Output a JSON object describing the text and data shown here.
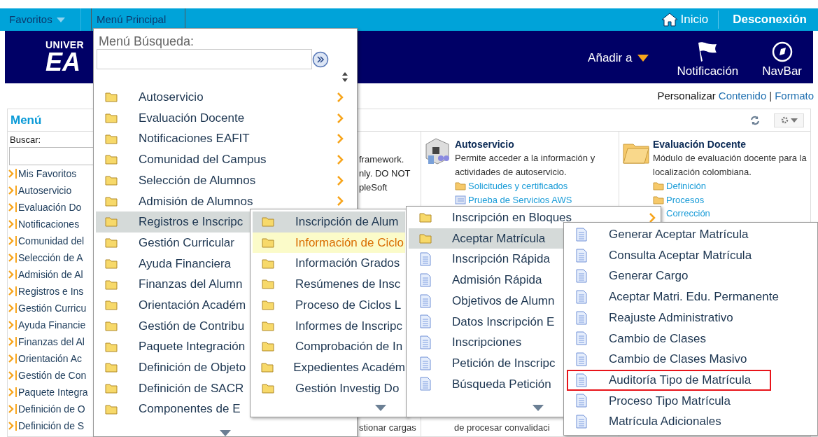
{
  "top_nav": {
    "favorites": "Favoritos",
    "main_menu": "Menú Principal",
    "home": "Inicio",
    "logout": "Desconexión"
  },
  "banner": {
    "logo_line_1": "UNIVER",
    "logo_line_2": "EA",
    "add_to": "Añadir a",
    "notification": "Notificación",
    "navbar": "NavBar"
  },
  "personalize": {
    "label": "Personalizar",
    "content_link": "Contenido",
    "separator": "|",
    "layout_link": "Formato"
  },
  "left_menu": {
    "title": "Menú",
    "search_label": "Buscar:",
    "items": [
      "Mis Favoritos",
      "Autoservicio",
      "Evaluación Do",
      "Notificaciones",
      "Comunidad del",
      "Selección de A",
      "Admisión de Al",
      "Registros e Ins",
      "Gestión Curricu",
      "Ayuda Financie",
      "Finanzas del Al",
      "Orientación Ac",
      "Gestión de Con",
      "Paquete Integra",
      "Definición de O",
      "Definición de S"
    ]
  },
  "pods": [
    {
      "kind": "partial",
      "lines": [
        "framework.",
        "nly. DO NOT",
        "pleSoft"
      ],
      "footer": "stionar cargas"
    },
    {
      "kind": "self_service",
      "title": "Autoservicio",
      "description": "Permite acceder a la información y actividades de autoservicio.",
      "links": [
        {
          "kind": "folder",
          "label": "Solicitudes y certificados"
        },
        {
          "kind": "page",
          "label": "Prueba de Servicios AWS"
        }
      ],
      "footer": "de procesar convalidaci"
    },
    {
      "kind": "folder",
      "title": "Evaluación Docente",
      "description": "Módulo de evaluación docente para la localización colombiana.",
      "links": [
        {
          "kind": "folder",
          "label": "Definición"
        },
        {
          "kind": "folder",
          "label": "Procesos"
        },
        {
          "kind": "none",
          "label": "Corrección"
        }
      ]
    }
  ],
  "menu_search": {
    "label": "Menú Búsqueda:"
  },
  "menus": [
    {
      "items": [
        {
          "label": "Autoservicio",
          "kind": "folder",
          "selected": false,
          "submenu": true
        },
        {
          "label": "Evaluación Docente",
          "kind": "folder",
          "selected": false,
          "submenu": true
        },
        {
          "label": "Notificaciones EAFIT",
          "kind": "folder",
          "selected": false,
          "submenu": true
        },
        {
          "label": "Comunidad del Campus",
          "kind": "folder",
          "selected": false,
          "submenu": true
        },
        {
          "label": "Selección de Alumnos",
          "kind": "folder",
          "selected": false,
          "submenu": true
        },
        {
          "label": "Admisión de Alumnos",
          "kind": "folder",
          "selected": false,
          "submenu": true
        },
        {
          "label": "Registros e Inscripc",
          "kind": "folder",
          "selected": true,
          "submenu": false
        },
        {
          "label": "Gestión Curricular",
          "kind": "folder",
          "selected": false,
          "submenu": false
        },
        {
          "label": "Ayuda Financiera",
          "kind": "folder",
          "selected": false,
          "submenu": false
        },
        {
          "label": "Finanzas del Alumn",
          "kind": "folder",
          "selected": false,
          "submenu": false
        },
        {
          "label": "Orientación Académ",
          "kind": "folder",
          "selected": false,
          "submenu": false
        },
        {
          "label": "Gestión de Contribu",
          "kind": "folder",
          "selected": false,
          "submenu": false
        },
        {
          "label": "Paquete Integración",
          "kind": "folder",
          "selected": false,
          "submenu": false
        },
        {
          "label": "Definición de Objeto",
          "kind": "folder",
          "selected": false,
          "submenu": false
        },
        {
          "label": "Definición de SACR",
          "kind": "folder",
          "selected": false,
          "submenu": false
        },
        {
          "label": "Componentes de E",
          "kind": "folder",
          "selected": false,
          "submenu": false
        }
      ]
    },
    {
      "items": [
        {
          "label": "Inscripción de Alum",
          "kind": "folder",
          "selected": true,
          "hovered": false
        },
        {
          "label": "Información de Ciclo",
          "kind": "folder",
          "selected": false,
          "hovered": true
        },
        {
          "label": "Información Grados",
          "kind": "folder",
          "selected": false,
          "hovered": false
        },
        {
          "label": "Resúmenes de Insc",
          "kind": "folder",
          "selected": false,
          "hovered": false
        },
        {
          "label": "Proceso de Ciclos L",
          "kind": "folder",
          "selected": false,
          "hovered": false
        },
        {
          "label": "Informes de Inscripc",
          "kind": "folder",
          "selected": false,
          "hovered": false
        },
        {
          "label": "Comprobación de In",
          "kind": "folder",
          "selected": false,
          "hovered": false
        },
        {
          "label": "Expedientes Académ",
          "kind": "folder",
          "selected": false,
          "hovered": false
        },
        {
          "label": "Gestión Investig Do",
          "kind": "folder",
          "selected": false,
          "hovered": false
        }
      ]
    },
    {
      "items": [
        {
          "label": "Inscripción en Bloques",
          "kind": "folder",
          "selected": false,
          "submenu": true
        },
        {
          "label": "Aceptar Matrícula",
          "kind": "folder",
          "selected": true,
          "submenu": false
        },
        {
          "label": "Inscripción Rápida",
          "kind": "page",
          "selected": false,
          "submenu": false
        },
        {
          "label": "Admisión Rápida",
          "kind": "page",
          "selected": false,
          "submenu": false
        },
        {
          "label": "Objetivos de Alumn",
          "kind": "page",
          "selected": false,
          "submenu": false
        },
        {
          "label": "Datos Inscripción E",
          "kind": "page",
          "selected": false,
          "submenu": false
        },
        {
          "label": "Inscripciones",
          "kind": "page",
          "selected": false,
          "submenu": false
        },
        {
          "label": "Petición de Inscripc",
          "kind": "page",
          "selected": false,
          "submenu": false
        },
        {
          "label": "Búsqueda Petición",
          "kind": "page",
          "selected": false,
          "submenu": false
        }
      ]
    },
    {
      "items": [
        {
          "label": "Generar Aceptar Matrícula",
          "kind": "page",
          "selected": false,
          "annotated": false
        },
        {
          "label": "Consulta Aceptar Matrícula",
          "kind": "page",
          "selected": false,
          "annotated": false
        },
        {
          "label": "Generar Cargo",
          "kind": "page",
          "selected": false,
          "annotated": false
        },
        {
          "label": "Aceptar Matri. Edu. Permanente",
          "kind": "page",
          "selected": false,
          "annotated": false
        },
        {
          "label": "Reajuste Administrativo",
          "kind": "page",
          "selected": false,
          "annotated": false
        },
        {
          "label": "Cambio de Clases",
          "kind": "page",
          "selected": false,
          "annotated": false
        },
        {
          "label": "Cambio de Clases Masivo",
          "kind": "page",
          "selected": false,
          "annotated": false
        },
        {
          "label": "Auditoría Tipo de Matrícula",
          "kind": "page",
          "selected": false,
          "annotated": true
        },
        {
          "label": "Proceso Tipo Matrícula",
          "kind": "page",
          "selected": false,
          "annotated": false
        },
        {
          "label": "Matrícula Adicionales",
          "kind": "page",
          "selected": false,
          "annotated": false
        }
      ]
    }
  ]
}
